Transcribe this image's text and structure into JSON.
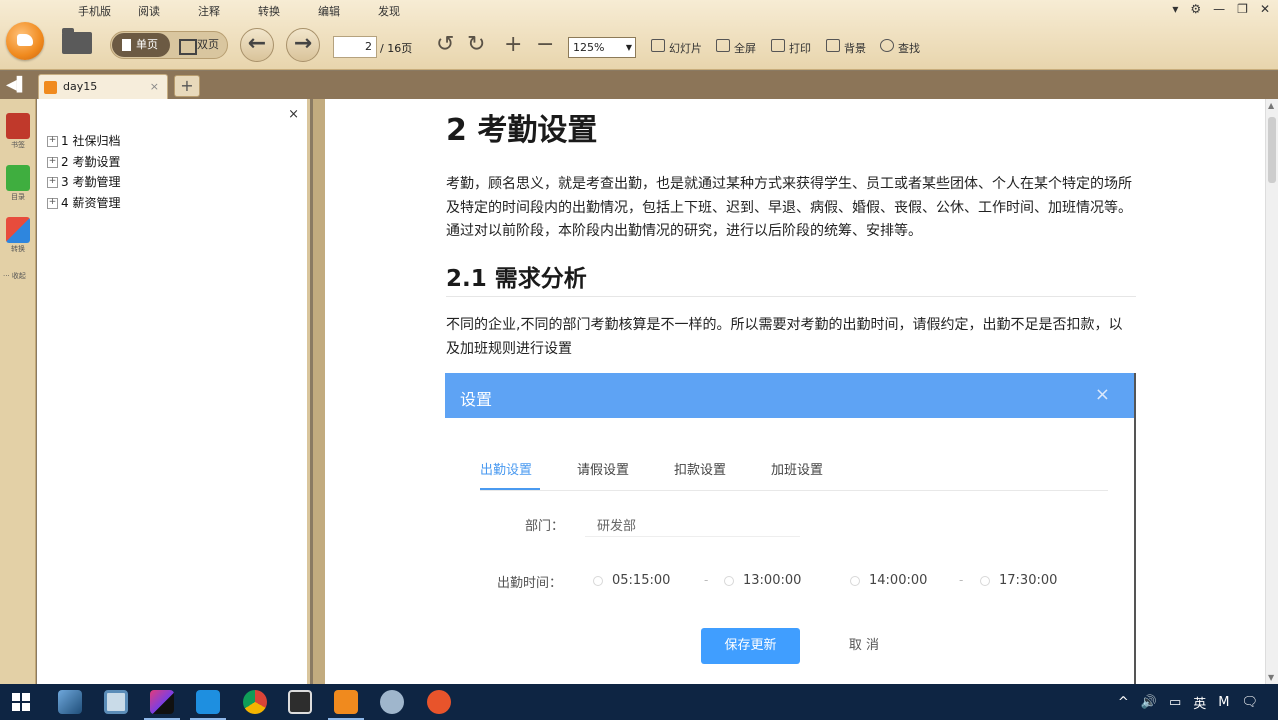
{
  "menu": [
    "手机版",
    "阅读",
    "注释",
    "转换",
    "编辑",
    "发现"
  ],
  "window_controls": [
    "▾",
    "⚙",
    "—",
    "❐",
    "✕"
  ],
  "toolbar": {
    "view_single": "单页",
    "view_double": "双页",
    "page_current": "2",
    "page_total": "/ 16页",
    "zoom": "125%",
    "slideshow": "幻灯片",
    "fullscreen": "全屏",
    "print": "打印",
    "background": "背景",
    "find": "查找"
  },
  "tab": {
    "title": "day15",
    "close": "×",
    "add": "+"
  },
  "rail": {
    "bookmark": "书签",
    "outline": "目录",
    "convert": "转换",
    "more": "··· 收起"
  },
  "outline": {
    "close": "×",
    "items": [
      "1 社保归档",
      "2 考勤设置",
      "3 考勤管理",
      "4 薪资管理"
    ]
  },
  "document": {
    "heading": "2 考勤设置",
    "para1": "考勤，顾名思义，就是考查出勤，也是就通过某种方式来获得学生、员工或者某些团体、个人在某个特定的场所及特定的时间段内的出勤情况，包括上下班、迟到、早退、病假、婚假、丧假、公休、工作时间、加班情况等。通过对以前阶段，本阶段内出勤情况的研究，进行以后阶段的统筹、安排等。",
    "subheading": "2.1 需求分析",
    "para2": "不同的企业,不同的部门考勤核算是不一样的。所以需要对考勤的出勤时间，请假约定，出勤不足是否扣款，以及加班规则进行设置"
  },
  "dialog": {
    "title": "设置",
    "close": "×",
    "tabs": [
      "出勤设置",
      "请假设置",
      "扣款设置",
      "加班设置"
    ],
    "dept_label": "部门：",
    "dept_value": "研发部",
    "time_label": "出勤时间：",
    "times": [
      "05:15:00",
      "13:00:00",
      "14:00:00",
      "17:30:00"
    ],
    "save": "保存更新",
    "cancel": "取 消"
  },
  "taskbar": {
    "apps": [
      "blue-swirl-app",
      "file-explorer",
      "intellij-idea",
      "vscode",
      "chrome",
      "typora",
      "pdf-reader",
      "feather-app",
      "red-circle-app"
    ],
    "tray": [
      "^",
      "🔊",
      "▭",
      "英",
      "M",
      "🗨"
    ]
  },
  "colors": {
    "toolbar_bg": "#f0e2c4",
    "tab_bar": "#8c7558",
    "dialog_header": "#5ea3f4",
    "primary_button": "#409eff",
    "taskbar": "#0e2543",
    "accent_orange": "#f08a1e"
  }
}
